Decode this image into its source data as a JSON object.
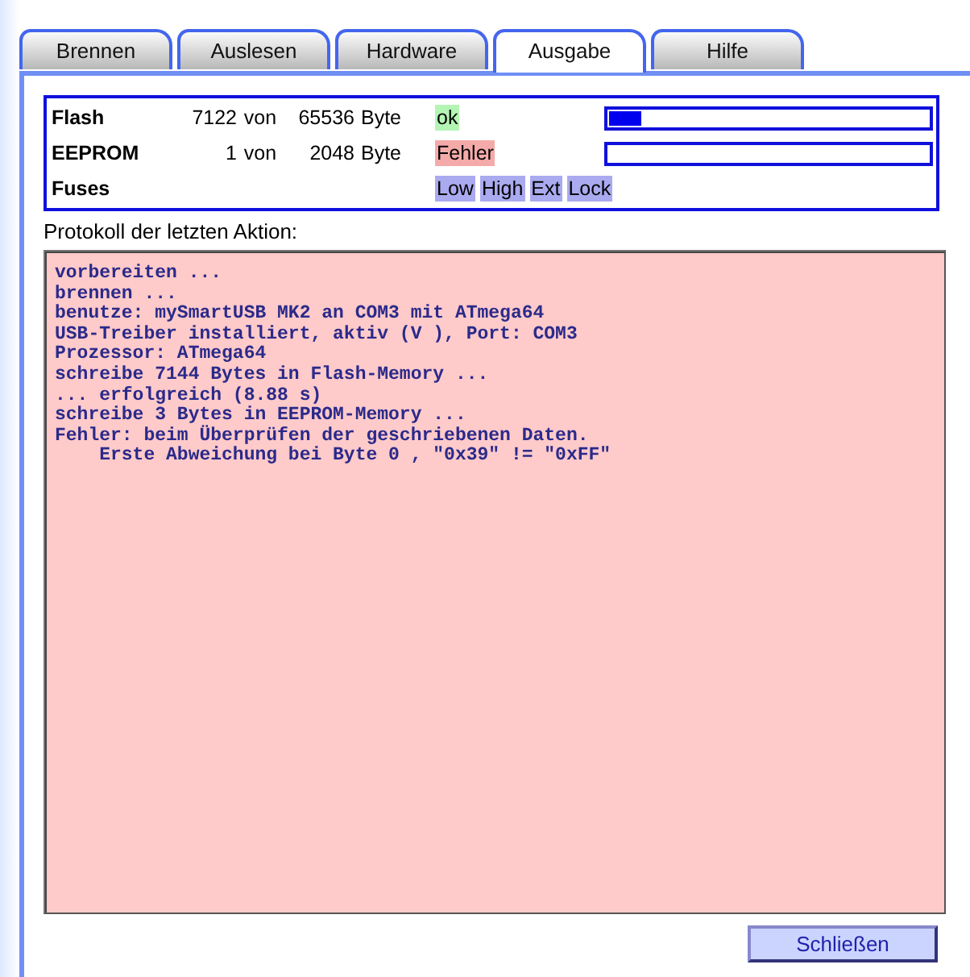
{
  "tabs": [
    {
      "label": "Brennen",
      "selected": false
    },
    {
      "label": "Auslesen",
      "selected": false
    },
    {
      "label": "Hardware",
      "selected": false
    },
    {
      "label": "Ausgabe",
      "selected": true
    },
    {
      "label": "Hilfe",
      "selected": false
    }
  ],
  "memory": [
    {
      "name": "Flash",
      "used": "7122",
      "of": "von",
      "size": "65536",
      "unit": "Byte",
      "status": "ok",
      "color": "#b4f5b4",
      "level": 0.1
    },
    {
      "name": "EEPROM",
      "used": "1",
      "of": "von",
      "size": "2048",
      "unit": "Byte",
      "status": "Fehler",
      "color": "#f5aaaa",
      "level": 0
    }
  ],
  "fuses": {
    "name": "Fuses",
    "items": [
      "Low",
      "High",
      "Ext",
      "Lock"
    ]
  },
  "log": {
    "title": "Protokoll der letzten Aktion:",
    "lines": [
      "vorbereiten ...",
      "brennen ...",
      "benutze: mySmartUSB MK2 an COM3 mit ATmega64",
      "USB-Treiber installiert, aktiv (V ), Port: COM3",
      "Prozessor: ATmega64",
      "schreibe 7144 Bytes in Flash-Memory ...",
      "... erfolgreich (8.88 s)",
      "schreibe 3 Bytes in EEPROM-Memory ...",
      "Fehler: beim Überprüfen der geschriebenen Daten.",
      "    Erste Abweichung bei Byte 0 , \"0x39\" != \"0xFF\""
    ]
  },
  "buttons": [
    "Schließen"
  ]
}
